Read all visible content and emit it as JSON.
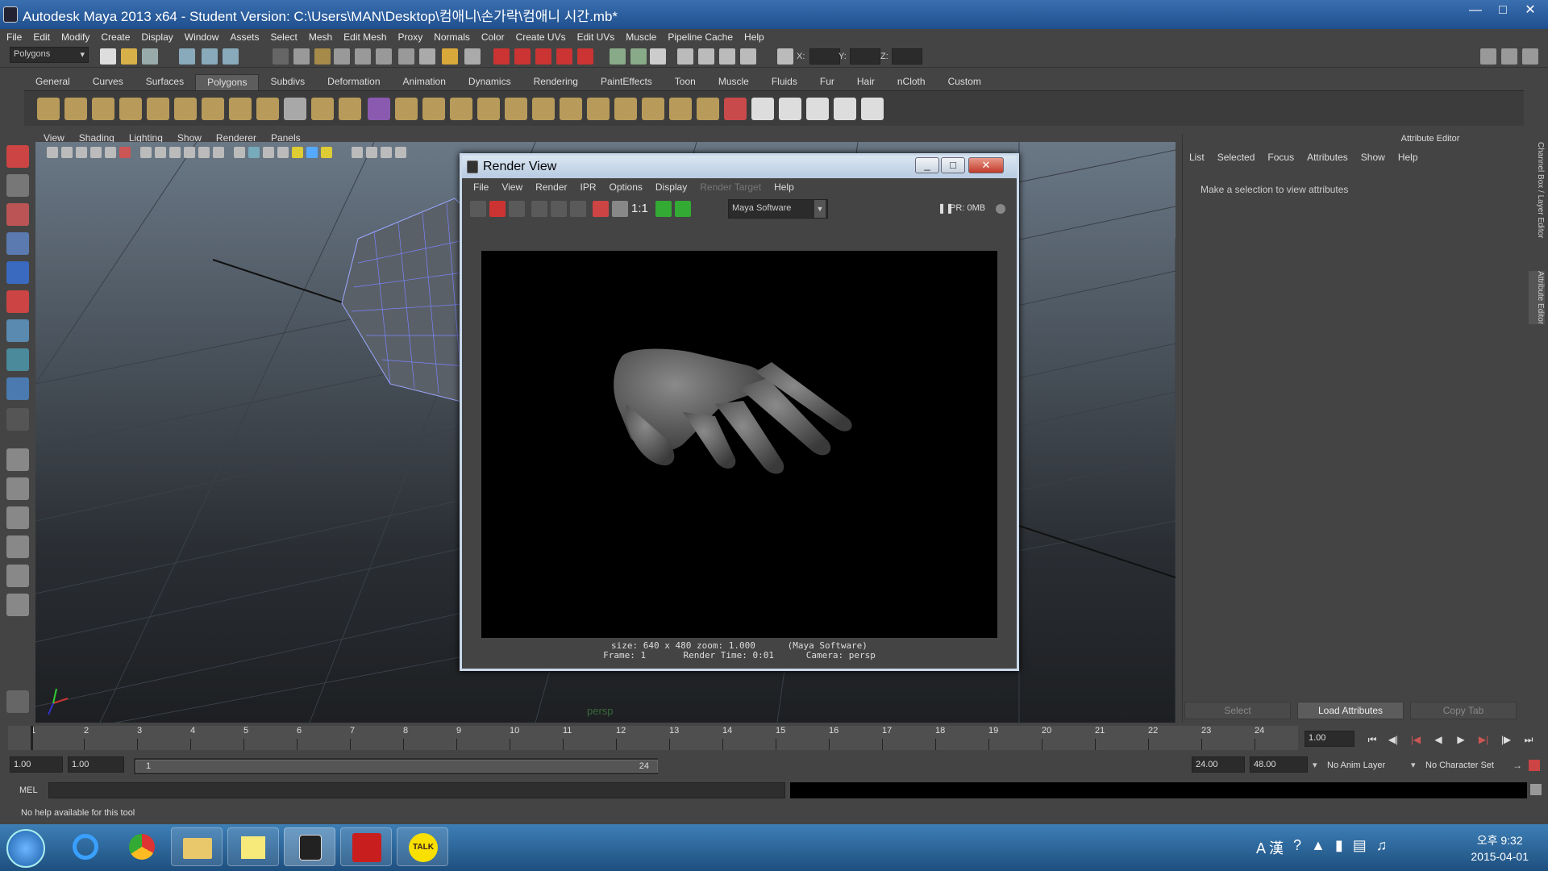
{
  "window": {
    "title": "Autodesk Maya 2013 x64 - Student Version: C:\\Users\\MAN\\Desktop\\컴애니\\손가락\\컴애니 시간.mb*"
  },
  "menubar": [
    "File",
    "Edit",
    "Modify",
    "Create",
    "Display",
    "Window",
    "Assets",
    "Select",
    "Mesh",
    "Edit Mesh",
    "Proxy",
    "Normals",
    "Color",
    "Create UVs",
    "Edit UVs",
    "Muscle",
    "Pipeline Cache",
    "Help"
  ],
  "statusline": {
    "menuset": "Polygons",
    "x_label": "X:",
    "y_label": "Y:",
    "z_label": "Z:"
  },
  "shelf_tabs": [
    "General",
    "Curves",
    "Surfaces",
    "Polygons",
    "Subdivs",
    "Deformation",
    "Animation",
    "Dynamics",
    "Rendering",
    "PaintEffects",
    "Toon",
    "Muscle",
    "Fluids",
    "Fur",
    "Hair",
    "nCloth",
    "Custom"
  ],
  "shelf_active": "Polygons",
  "viewport": {
    "menu": [
      "View",
      "Shading",
      "Lighting",
      "Show",
      "Renderer",
      "Panels"
    ],
    "camera_label": "persp"
  },
  "render_view": {
    "title": "Render View",
    "menu": [
      "File",
      "View",
      "Render",
      "IPR",
      "Options",
      "Display",
      "Render Target",
      "Help"
    ],
    "ratio_label": "1:1",
    "renderer": "Maya Software",
    "ipr_status": "IPR: 0MB",
    "info_line1": "size: 640 x 480 zoom: 1.000      (Maya Software)",
    "info_line2": "Frame: 1       Render Time: 0:01      Camera: persp"
  },
  "attribute_editor": {
    "title": "Attribute Editor",
    "menu": [
      "List",
      "Selected",
      "Focus",
      "Attributes",
      "Show",
      "Help"
    ],
    "message": "Make a selection to view attributes",
    "buttons": {
      "select": "Select",
      "load": "Load Attributes",
      "copy": "Copy Tab"
    },
    "side_tabs": [
      "Channel Box / Layer Editor",
      "Attribute Editor"
    ]
  },
  "time_slider": {
    "ticks": [
      "1",
      "2",
      "3",
      "4",
      "5",
      "6",
      "7",
      "8",
      "9",
      "10",
      "11",
      "12",
      "13",
      "14",
      "15",
      "16",
      "17",
      "18",
      "19",
      "20",
      "21",
      "22",
      "23",
      "24"
    ],
    "current_frame": "1.00"
  },
  "range_slider": {
    "start": "1.00",
    "playback_start": "1.00",
    "range_low": "1",
    "range_high": "24",
    "playback_end": "24.00",
    "end": "48.00",
    "anim_layer": "No Anim Layer",
    "character_set": "No Character Set"
  },
  "command_line": {
    "label": "MEL",
    "help": "No help available for this tool"
  },
  "taskbar": {
    "kakao_label": "TALK",
    "ime": "A 漢",
    "time": "오후 9:32",
    "date": "2015-04-01"
  }
}
